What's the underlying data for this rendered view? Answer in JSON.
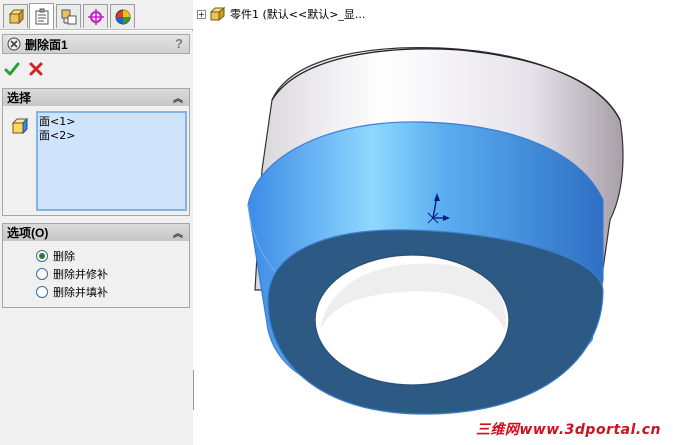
{
  "tabs": [
    {
      "name": "featuremanager-tab",
      "icon": "feature-tree-icon"
    },
    {
      "name": "propertymanager-tab",
      "icon": "property-manager-icon"
    },
    {
      "name": "configurationmanager-tab",
      "icon": "configuration-icon"
    },
    {
      "name": "dimxpert-tab",
      "icon": "crosshair-icon"
    },
    {
      "name": "display-tab",
      "icon": "appearance-icon"
    }
  ],
  "property_manager": {
    "title": "删除面1",
    "help": "?",
    "ok_icon": "checkmark-icon",
    "cancel_icon": "cross-icon"
  },
  "selection_group": {
    "title": "选择",
    "items": [
      "面<1>",
      "面<2>"
    ]
  },
  "options_group": {
    "title": "选项(O)",
    "options": [
      {
        "label": "删除",
        "selected": true
      },
      {
        "label": "删除并修补",
        "selected": false
      },
      {
        "label": "删除并填补",
        "selected": false
      }
    ]
  },
  "feature_tree": {
    "expander": "+",
    "label": "零件1  (默认<<默认>_显..."
  },
  "watermark": "三维网www.3dportal.cn",
  "colors": {
    "selected_face": "#3f93e8",
    "selected_face_dark": "#2a5a86",
    "watermark": "#d10f1e"
  }
}
